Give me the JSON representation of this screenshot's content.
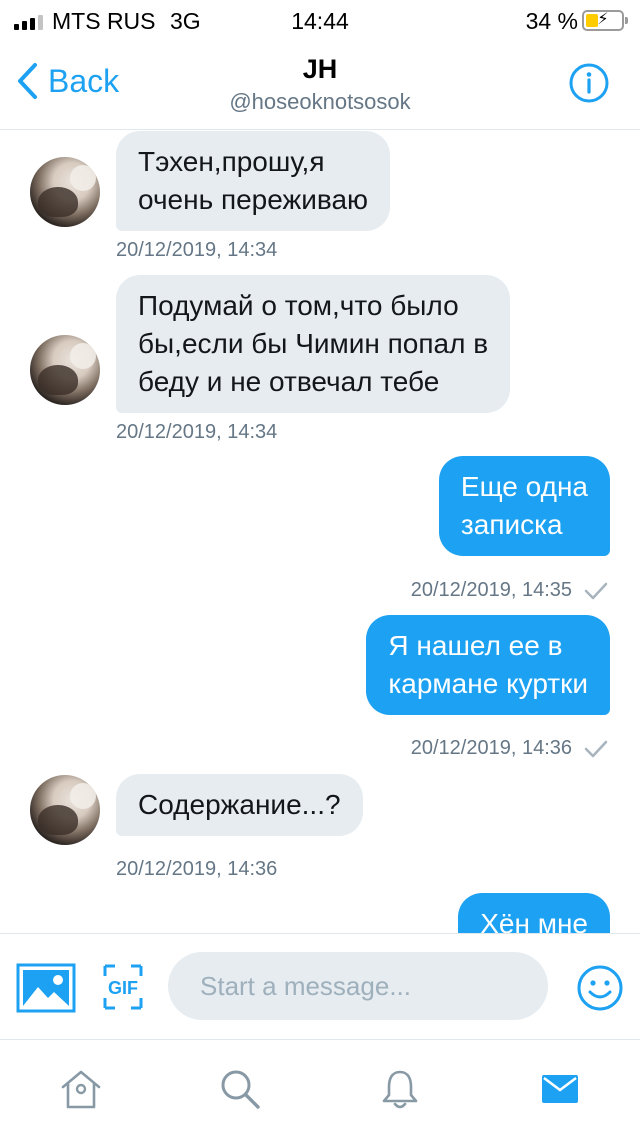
{
  "status_bar": {
    "carrier": "MTS RUS",
    "network": "3G",
    "time": "14:44",
    "battery_percent": "34 %",
    "battery_level": 0.34,
    "battery_icon": "battery-charging-icon"
  },
  "header": {
    "back_label": "Back",
    "title": "JH",
    "handle": "@hoseoknotsosok",
    "info_icon": "info-icon"
  },
  "messages": [
    {
      "direction": "in",
      "lines": [
        "Тэхен,прошу,я",
        "очень переживаю"
      ],
      "timestamp": "20/12/2019, 14:34"
    },
    {
      "direction": "in",
      "lines": [
        "Подумай о том,что было",
        "бы,если бы Чимин попал в",
        "беду и не отвечал тебе"
      ],
      "timestamp": "20/12/2019, 14:34"
    },
    {
      "direction": "out",
      "lines": [
        "Еще одна",
        "записка"
      ],
      "timestamp": "20/12/2019, 14:35",
      "status_icon": "checkmark-icon"
    },
    {
      "direction": "out",
      "lines": [
        "Я нашел ее в",
        "кармане куртки"
      ],
      "timestamp": "20/12/2019, 14:36",
      "status_icon": "checkmark-icon"
    },
    {
      "direction": "in",
      "lines": [
        "Содержание...?"
      ],
      "timestamp": "20/12/2019, 14:36"
    },
    {
      "direction": "out",
      "lines": [
        "Хён мне"
      ],
      "timestamp": ""
    }
  ],
  "composer": {
    "placeholder": "Start a message...",
    "value": "",
    "media_icon": "image-icon",
    "gif_label": "GIF",
    "emoji_icon": "emoji-icon"
  },
  "tabbar": {
    "items": [
      {
        "name": "home",
        "icon": "home-icon",
        "active": false
      },
      {
        "name": "search",
        "icon": "search-icon",
        "active": false
      },
      {
        "name": "notifications",
        "icon": "bell-icon",
        "active": false
      },
      {
        "name": "messages",
        "icon": "mail-icon",
        "active": true
      }
    ]
  },
  "colors": {
    "accent": "#1da1f2",
    "incoming_bubble": "#e6ecf0",
    "secondary_text": "#657786",
    "inactive_icon": "#8899a6"
  }
}
